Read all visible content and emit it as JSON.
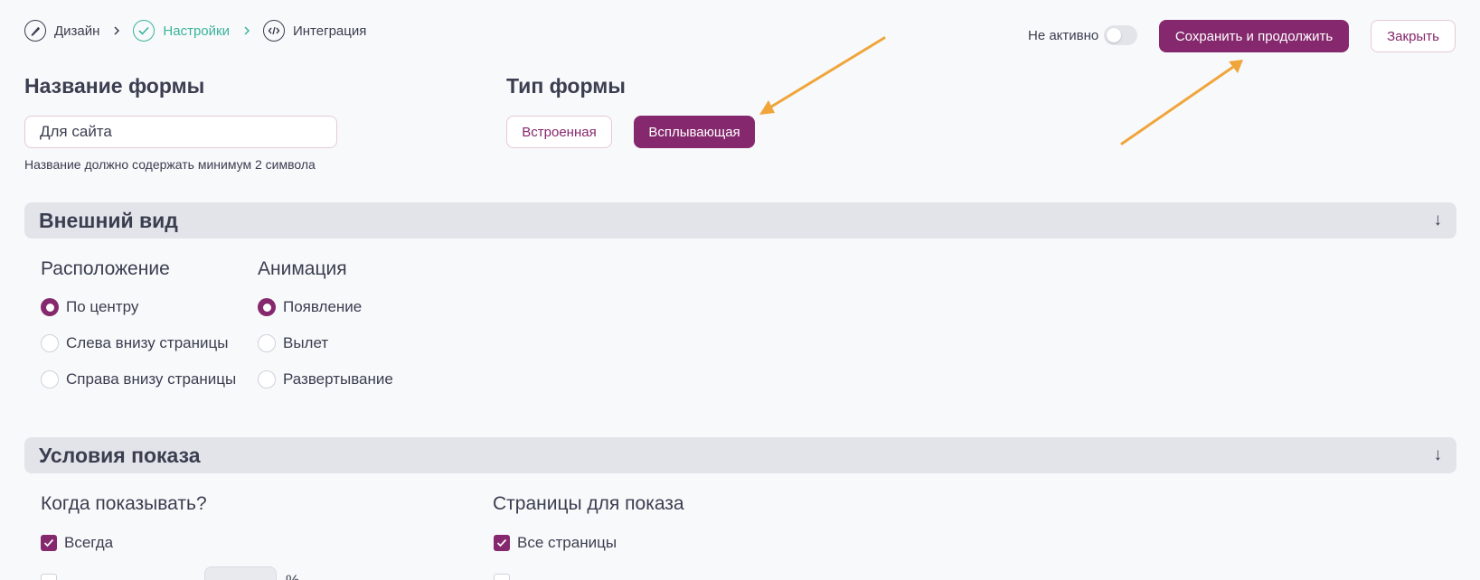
{
  "breadcrumb": {
    "steps": [
      {
        "label": "Дизайн",
        "icon": "pencil-icon",
        "active": false
      },
      {
        "label": "Настройки",
        "icon": "check-icon",
        "active": true
      },
      {
        "label": "Интеграция",
        "icon": "code-icon",
        "active": false
      }
    ]
  },
  "header": {
    "status_label": "Не активно",
    "save_label": "Сохранить и продолжить",
    "close_label": "Закрыть"
  },
  "form_name": {
    "title": "Название формы",
    "value": "Для сайта",
    "hint": "Название должно содержать минимум 2 символа"
  },
  "form_type": {
    "title": "Тип формы",
    "options": [
      "Встроенная",
      "Всплывающая"
    ],
    "selected": "Всплывающая"
  },
  "appearance": {
    "title": "Внешний вид",
    "arrow": "↓",
    "position": {
      "title": "Расположение",
      "options": [
        "По центру",
        "Слева внизу страницы",
        "Справа внизу страницы"
      ],
      "selected": "По центру"
    },
    "animation": {
      "title": "Анимация",
      "options": [
        "Появление",
        "Вылет",
        "Развертывание"
      ],
      "selected": "Появление"
    }
  },
  "display_conditions": {
    "title": "Условия показа",
    "arrow": "↓",
    "when": {
      "title": "Когда показывать?",
      "options": [
        "Всегда"
      ],
      "checked": [
        "Всегда"
      ],
      "partial_row": "%"
    },
    "pages": {
      "title": "Страницы для показа",
      "options": [
        "Все страницы"
      ],
      "checked": [
        "Все страницы"
      ]
    }
  },
  "colors": {
    "accent": "#85286d",
    "active_step": "#3bb39c",
    "annotation_arrow": "#f0a53a"
  }
}
